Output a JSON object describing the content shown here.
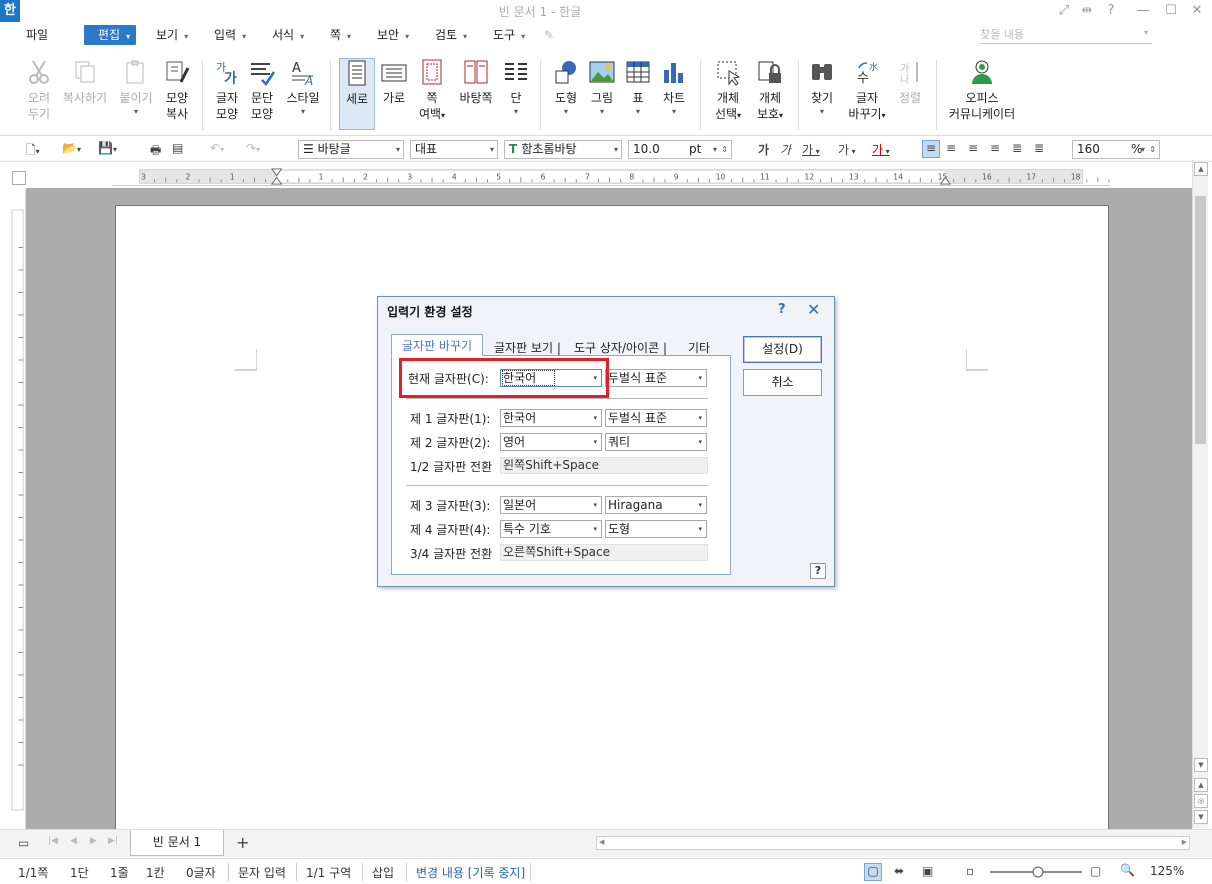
{
  "window": {
    "title": "빈 문서 1 - 한글",
    "logo": "한"
  },
  "menu": {
    "items": [
      {
        "label": "파일"
      },
      {
        "label": "편집"
      },
      {
        "label": "보기"
      },
      {
        "label": "입력"
      },
      {
        "label": "서식"
      },
      {
        "label": "쪽"
      },
      {
        "label": "보안"
      },
      {
        "label": "검토"
      },
      {
        "label": "도구"
      }
    ],
    "search_placeholder": "찾을 내용"
  },
  "ribbon": {
    "cut": [
      "오려",
      "두기"
    ],
    "copy": "복사하기",
    "paste": "붙이기",
    "format_copy": [
      "모양",
      "복사"
    ],
    "char_shape": [
      "글자",
      "모양"
    ],
    "para_shape": [
      "문단",
      "모양"
    ],
    "style": "스타일",
    "vertical": "세로",
    "horizontal": "가로",
    "margin": [
      "쪽",
      "여백"
    ],
    "bg": "바탕쪽",
    "columns": "단",
    "shape": "도형",
    "picture": "그림",
    "table": "표",
    "chart": "차트",
    "obj_select": [
      "개체",
      "선택"
    ],
    "obj_protect": [
      "개체",
      "보호"
    ],
    "find": "찾기",
    "replace": [
      "글자",
      "바꾸기"
    ],
    "align": "정렬",
    "office": [
      "오피스",
      "커뮤니케이터"
    ]
  },
  "toolbar": {
    "style": "바탕글",
    "lang": "대표",
    "font": "함초롬바탕",
    "size": "10.0",
    "unit": "pt",
    "bold": "가",
    "italic": "가",
    "underline": "가",
    "spacing": "가",
    "color": "가",
    "zoom": "160",
    "zoom_unit": "%"
  },
  "ruler": {
    "labels": [
      "3",
      "2",
      "1",
      "",
      "1",
      "2",
      "3",
      "4",
      "5",
      "6",
      "7",
      "8",
      "9",
      "10",
      "11",
      "12",
      "13",
      "14",
      "15",
      "16",
      "17",
      "18"
    ]
  },
  "dialog": {
    "title": "입력기 환경 설정",
    "help": "?",
    "close": "✕",
    "tabs": [
      "글자판 바꾸기",
      "글자판 보기",
      "도구 상자/아이콘",
      "기타"
    ],
    "buttons": {
      "set": "설정(D)",
      "cancel": "취소"
    },
    "current": {
      "label": "현재 글자판(C):",
      "value": "한국어",
      "layout": "두벌식 표준"
    },
    "board1": {
      "label": "제 1 글자판(1):",
      "value": "한국어",
      "layout": "두벌식 표준"
    },
    "board2": {
      "label": "제 2 글자판(2):",
      "value": "영어",
      "layout": "쿼티"
    },
    "switch12": {
      "label": "1/2 글자판 전환",
      "value": "왼쪽Shift+Space"
    },
    "board3": {
      "label": "제 3 글자판(3):",
      "value": "일본어",
      "layout": "Hiragana"
    },
    "board4": {
      "label": "제 4 글자판(4):",
      "value": "특수 기호",
      "layout": "도형"
    },
    "switch34": {
      "label": "3/4 글자판 전환",
      "value": "오른쪽Shift+Space"
    },
    "q": "?"
  },
  "tabstrip": {
    "doc_tab": "빈 문서 1",
    "add": "+"
  },
  "status": {
    "page": "1/1쪽",
    "col": "1단",
    "line": "1줄",
    "pos": "1칸",
    "chars": "0글자",
    "input": "문자 입력",
    "section": "1/1 구역",
    "mode": "삽입",
    "changes": "변경 내용 [기록 중지]",
    "zoom": "125%"
  },
  "colors": {
    "accent": "#2b79c8",
    "highlight": "#e0202a",
    "doc_bg": "#ababab"
  }
}
